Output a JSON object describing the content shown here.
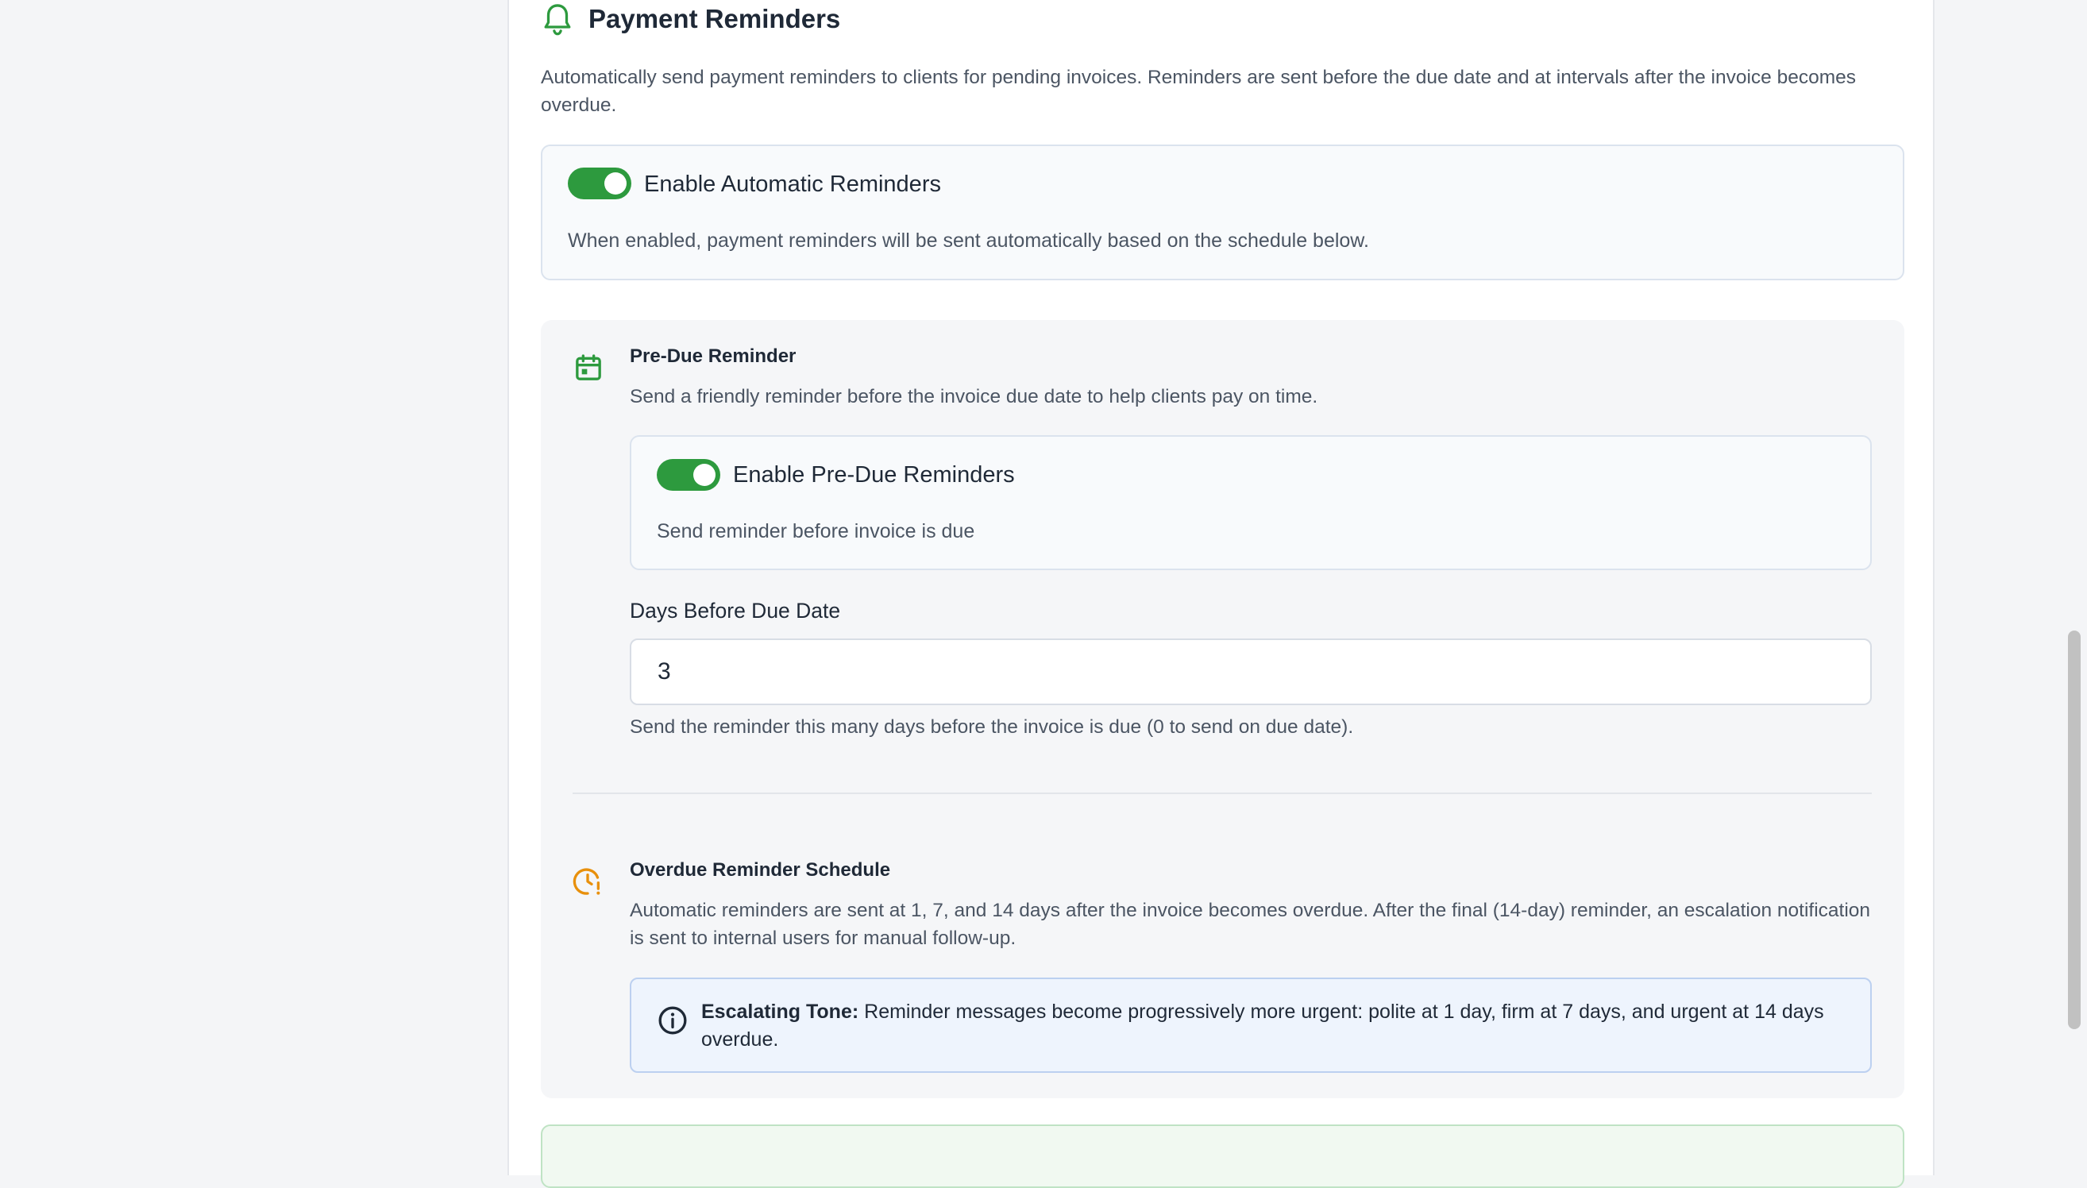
{
  "section": {
    "title": "Payment Reminders",
    "icon": "bell-icon",
    "description": "Automatically send payment reminders to clients for pending invoices. Reminders are sent before the due date and at intervals after the invoice becomes overdue."
  },
  "auto_reminders": {
    "enabled": true,
    "label": "Enable Automatic Reminders",
    "help": "When enabled, payment reminders will be sent automatically based on the schedule below."
  },
  "pre_due": {
    "icon": "calendar-icon",
    "title": "Pre-Due Reminder",
    "description": "Send a friendly reminder before the invoice due date to help clients pay on time.",
    "toggle_enabled": true,
    "toggle_label": "Enable Pre-Due Reminders",
    "toggle_help": "Send reminder before invoice is due",
    "days_label": "Days Before Due Date",
    "days_value": "3",
    "days_help": "Send the reminder this many days before the invoice is due (0 to send on due date)."
  },
  "overdue": {
    "icon": "clock-alert-icon",
    "title": "Overdue Reminder Schedule",
    "description": "Automatic reminders are sent at 1, 7, and 14 days after the invoice becomes overdue. After the final (14-day) reminder, an escalation notification is sent to internal users for manual follow-up.",
    "info_icon": "info-icon",
    "info_label": "Escalating Tone:",
    "info_text": "Reminder messages become progressively more urgent: polite at 1 day, firm at 7 days, and urgent at 14 days overdue."
  },
  "colors": {
    "accent_green": "#2d9a3e",
    "warning_orange": "#e8900c",
    "info_bg": "#eef4fd"
  }
}
